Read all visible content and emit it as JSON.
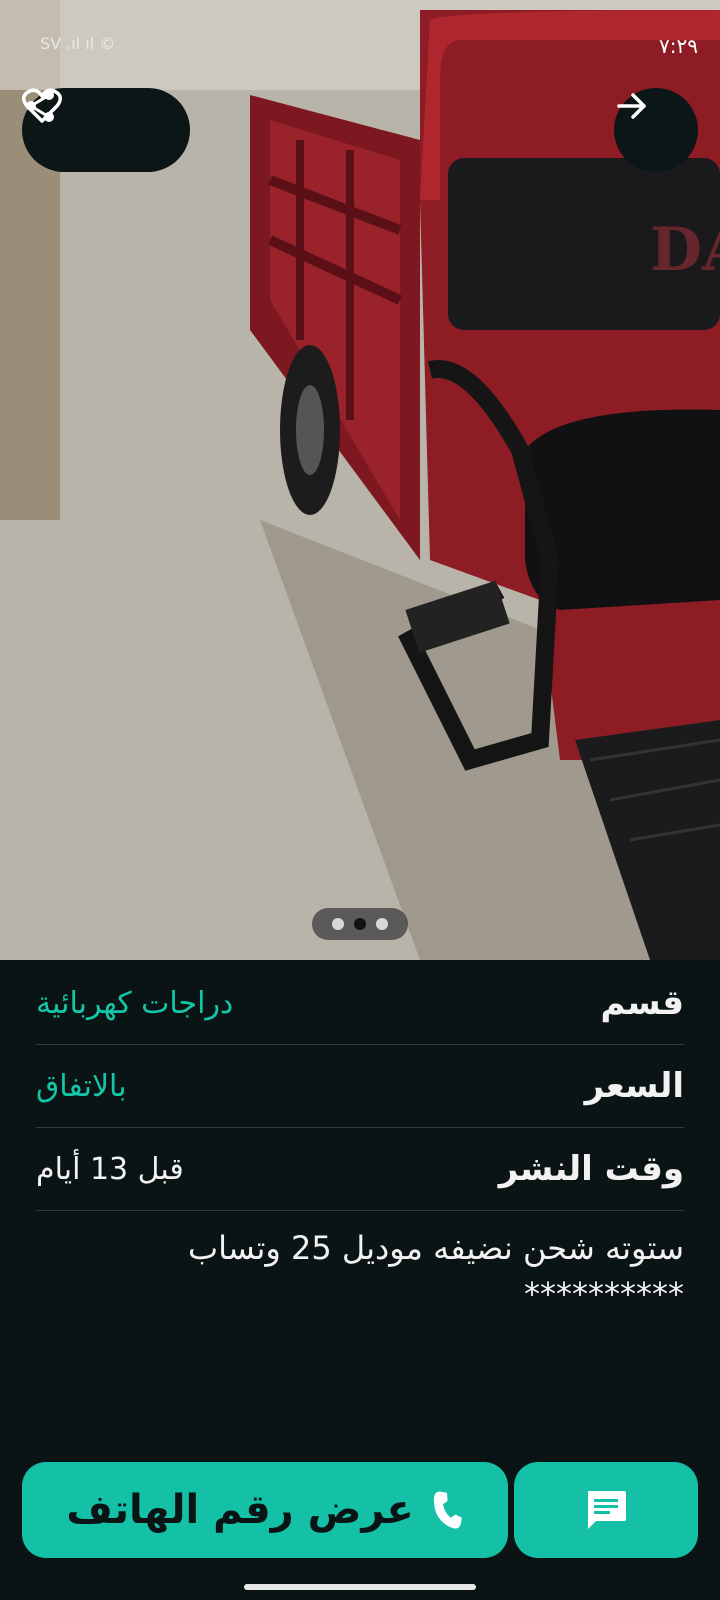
{
  "status_bar": {
    "time": "٧:٢٩",
    "left_indicators": "SV ‎.ıl ıl ©"
  },
  "top_actions": {
    "share_icon": "share-icon",
    "favorite_icon": "heart-outline-icon",
    "forward_icon": "arrow-right-icon"
  },
  "gallery": {
    "total_images": 3,
    "active_index": 1
  },
  "details": {
    "category_label": "قسم",
    "category_value": "دراجات كهربائية",
    "price_label": "السعر",
    "price_value": "بالاتفاق",
    "posted_label": "وقت النشر",
    "posted_value": "قبل 13 أيام",
    "description_line1": "ستوته شحن نضيفه موديل 25 وتساب",
    "description_line2": "**********"
  },
  "actions": {
    "show_phone_label": "عرض رقم الهاتف",
    "phone_icon": "phone-icon",
    "chat_icon": "chat-icon"
  },
  "colors": {
    "accent": "#14c1a6",
    "background": "#0b1414",
    "photo_vehicle": "#8e1c24"
  }
}
